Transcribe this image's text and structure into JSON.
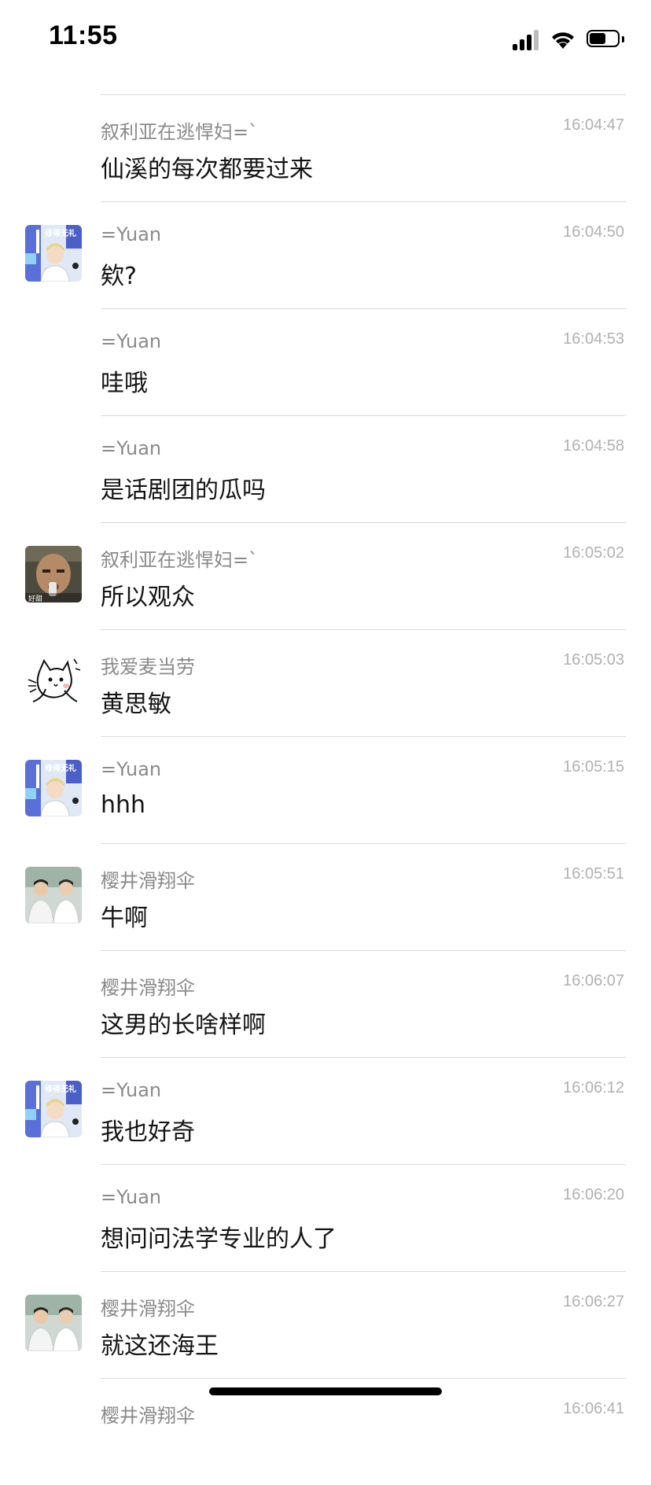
{
  "status_bar": {
    "time": "11:55",
    "battery_percent": 60
  },
  "messages": [
    {
      "sender": "叙利亚在逃悍妇=`",
      "time": "16:04:47",
      "text": "仙溪的每次都要过来",
      "avatar": null
    },
    {
      "sender": "=Yuan",
      "time": "16:04:50",
      "text": "欸?",
      "avatar": "yuan"
    },
    {
      "sender": "=Yuan",
      "time": "16:04:53",
      "text": "哇哦",
      "avatar": null
    },
    {
      "sender": "=Yuan",
      "time": "16:04:58",
      "text": "是话剧团的瓜吗",
      "avatar": null
    },
    {
      "sender": "叙利亚在逃悍妇=`",
      "time": "16:05:02",
      "text": "所以观众",
      "avatar": "face"
    },
    {
      "sender": "我爱麦当劳",
      "time": "16:05:03",
      "text": "黄思敏",
      "avatar": "cat"
    },
    {
      "sender": "=Yuan",
      "time": "16:05:15",
      "text": "hhh",
      "avatar": "yuan"
    },
    {
      "sender": "樱井滑翔伞",
      "time": "16:05:51",
      "text": "牛啊",
      "avatar": "duo"
    },
    {
      "sender": "樱井滑翔伞",
      "time": "16:06:07",
      "text": "这男的长啥样啊",
      "avatar": null
    },
    {
      "sender": "=Yuan",
      "time": "16:06:12",
      "text": "我也好奇",
      "avatar": "yuan"
    },
    {
      "sender": "=Yuan",
      "time": "16:06:20",
      "text": "想问问法学专业的人了",
      "avatar": null
    },
    {
      "sender": "樱井滑翔伞",
      "time": "16:06:27",
      "text": "就这还海王",
      "avatar": "duo"
    },
    {
      "sender": "樱井滑翔伞",
      "time": "16:06:41",
      "text": "",
      "avatar": null
    }
  ],
  "avatar_labels": {
    "yuan": "修得无礼",
    "face": "好甜"
  }
}
